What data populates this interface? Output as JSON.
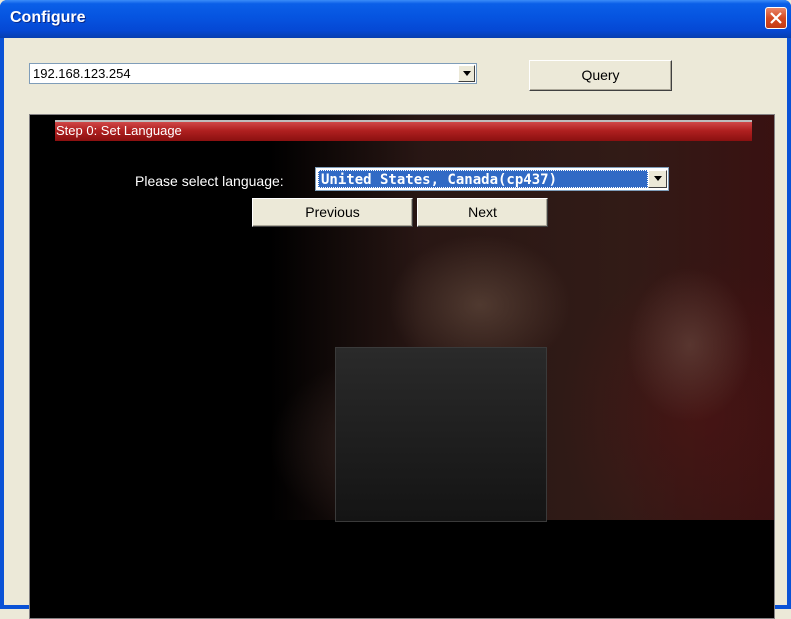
{
  "window": {
    "title": "Configure",
    "close_icon": "close-icon"
  },
  "address": {
    "value": "192.168.123.254"
  },
  "query_button": {
    "label": "Query"
  },
  "step": {
    "title": "Step 0: Set Language"
  },
  "language": {
    "label": "Please select language:",
    "selected": "United States, Canada(cp437)"
  },
  "nav": {
    "previous_label": "Previous",
    "next_label": "Next"
  },
  "colors": {
    "titlebar": "#0A52D6",
    "step_header": "#B02020",
    "selection": "#316AC5",
    "panel_bg": "#000000"
  }
}
